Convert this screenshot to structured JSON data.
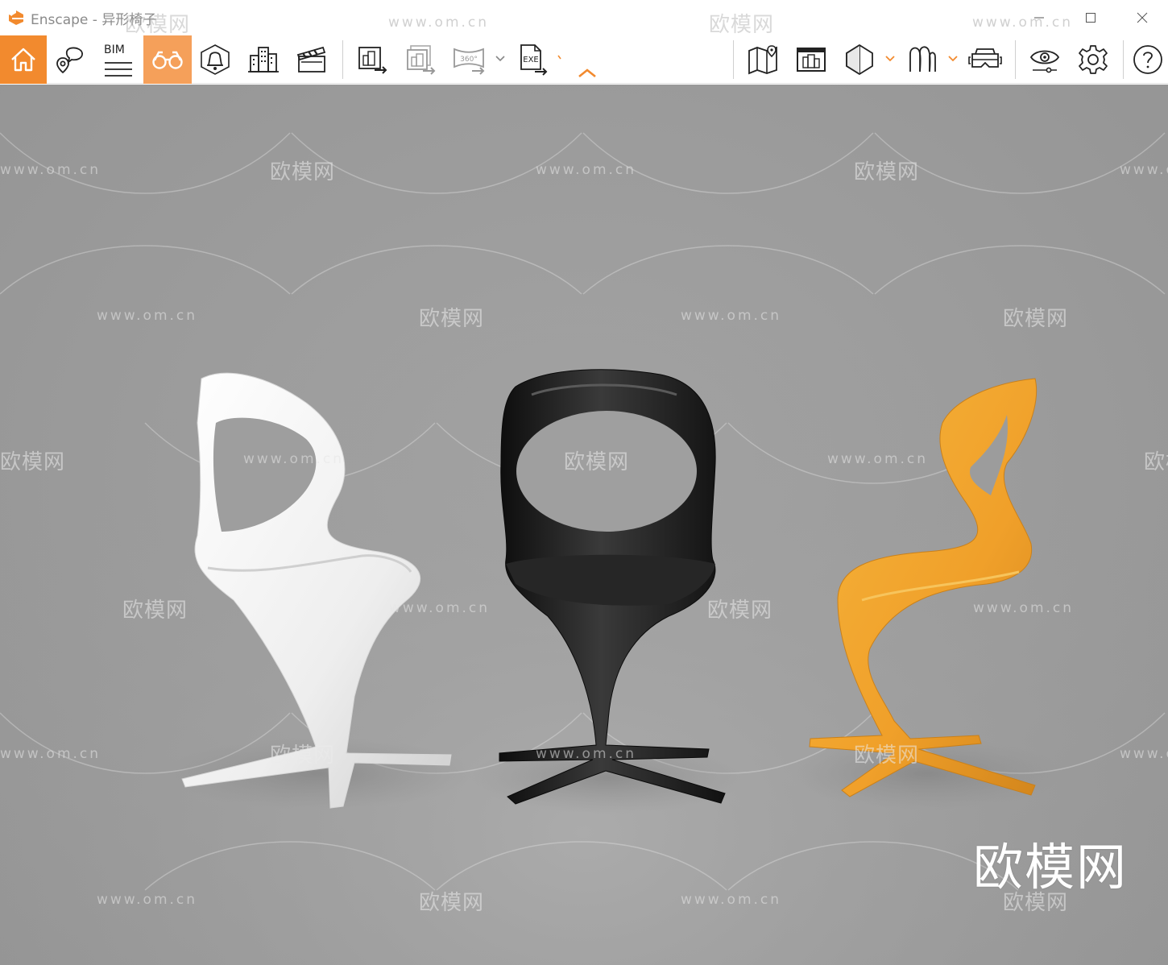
{
  "window": {
    "title": "Enscape - 异形椅子",
    "controls": {
      "minimize": "minimize",
      "maximize": "maximize",
      "close": "close"
    }
  },
  "toolbar": {
    "accent_color": "#f28a2e",
    "active_color": "#f5a05a",
    "bim_label": "BIM",
    "panorama_label": "360°",
    "exe_label": "EXE",
    "items": [
      {
        "name": "home",
        "icon": "home-icon"
      },
      {
        "name": "views",
        "icon": "location-comment-icon"
      },
      {
        "name": "bim",
        "icon": "bim-icon"
      },
      {
        "name": "walk-mode",
        "icon": "binoculars-icon",
        "active": true
      },
      {
        "name": "atmosphere",
        "icon": "bell-icon"
      },
      {
        "name": "assets",
        "icon": "buildings-icon"
      },
      {
        "name": "video",
        "icon": "clapperboard-icon"
      },
      {
        "name": "render-screenshot",
        "icon": "render-export-icon"
      },
      {
        "name": "batch-render",
        "icon": "batch-render-icon"
      },
      {
        "name": "panorama",
        "icon": "panorama-icon"
      },
      {
        "name": "export-exe",
        "icon": "exe-export-icon"
      },
      {
        "name": "map",
        "icon": "map-icon"
      },
      {
        "name": "preview-window",
        "icon": "window-icon"
      },
      {
        "name": "sections",
        "icon": "section-icon"
      },
      {
        "name": "materials",
        "icon": "material-icon"
      },
      {
        "name": "vr",
        "icon": "vr-headset-icon"
      },
      {
        "name": "visual-settings",
        "icon": "eye-icon"
      },
      {
        "name": "settings",
        "icon": "gear-icon"
      },
      {
        "name": "help",
        "icon": "help-icon"
      }
    ]
  },
  "viewport": {
    "watermark_text": "欧模网",
    "watermark_url": "www.om.cn",
    "brand_mark": "欧模网",
    "chairs": [
      {
        "color": "white",
        "hex": "#f1f1f1"
      },
      {
        "color": "black",
        "hex": "#1b1b1b"
      },
      {
        "color": "orange",
        "hex": "#f0a02a"
      }
    ]
  }
}
